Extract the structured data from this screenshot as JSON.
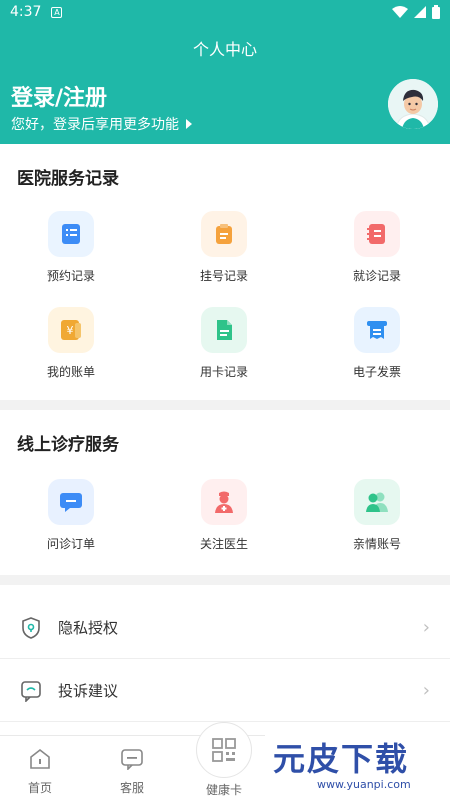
{
  "status_bar": {
    "time": "4:37",
    "notif_letter": "A"
  },
  "header": {
    "title": "个人中心",
    "login": "登录/注册",
    "subtitle": "您好，登录后享用更多功能"
  },
  "hospital": {
    "title": "医院服务记录",
    "items": [
      {
        "label": "预约记录",
        "icon": "appointment-icon",
        "bg": "#eaf4ff",
        "fg": "#3d8cf6"
      },
      {
        "label": "挂号记录",
        "icon": "clipboard-icon",
        "bg": "#fff3e6",
        "fg": "#f5a23d"
      },
      {
        "label": "就诊记录",
        "icon": "notebook-icon",
        "bg": "#ffefef",
        "fg": "#f26a6a"
      },
      {
        "label": "我的账单",
        "icon": "bill-icon",
        "bg": "#fff4e0",
        "fg": "#f0a833"
      },
      {
        "label": "用卡记录",
        "icon": "document-icon",
        "bg": "#e6f8f0",
        "fg": "#2fc38a"
      },
      {
        "label": "电子发票",
        "icon": "receipt-icon",
        "bg": "#e8f3ff",
        "fg": "#2f8ff0"
      }
    ]
  },
  "online": {
    "title": "线上诊疗服务",
    "items": [
      {
        "label": "问诊订单",
        "icon": "chat-icon",
        "bg": "#e8f1ff",
        "fg": "#3d8cf6"
      },
      {
        "label": "关注医生",
        "icon": "doctor-icon",
        "bg": "#ffefef",
        "fg": "#f26a6a"
      },
      {
        "label": "亲情账号",
        "icon": "family-icon",
        "bg": "#e6f8f0",
        "fg": "#2fc38a"
      }
    ]
  },
  "settings": [
    {
      "label": "隐私授权",
      "icon": "shield-icon"
    },
    {
      "label": "投诉建议",
      "icon": "feedback-icon"
    }
  ],
  "tabbar": {
    "home": "首页",
    "service": "客服",
    "card": "健康卡"
  },
  "watermark": {
    "main": "元皮下载",
    "url": "www.yuanpi.com"
  },
  "colors": {
    "primary": "#1fb8a8"
  }
}
